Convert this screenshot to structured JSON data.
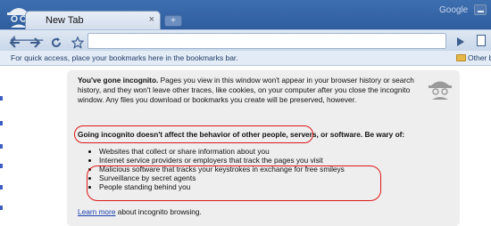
{
  "browser": {
    "brand": "Google",
    "tab": {
      "title": "New Tab",
      "close": "×"
    },
    "new_tab": "+"
  },
  "bookmarks_bar": {
    "hint": "For quick access, place your bookmarks here in the bookmarks bar.",
    "other": "Other b"
  },
  "incognito_page": {
    "heading": "You've gone incognito.",
    "intro": " Pages you view in this window won't appear in your browser history or search history, and they won't leave other traces, like cookies, on your computer after you close the incognito window. Any files you download or bookmarks you create will be preserved, however.",
    "warning_part1": "Going incognito doesn't affect the behavior of other people",
    "warning_part2": ", servers, or software. Be wary of:",
    "list": [
      "Websites that collect or share information about you",
      "Internet service providers or employers that track the pages you visit",
      "Malicious software that tracks your keystrokes in exchange for free smileys",
      "Surveillance by secret agents",
      "People standing behind you"
    ],
    "learn_more_link": "Learn more",
    "learn_more_rest": " about incognito browsing."
  },
  "colors": {
    "highlight": "#e01818",
    "link": "#1a3fb0",
    "panel": "#eeeeee"
  }
}
